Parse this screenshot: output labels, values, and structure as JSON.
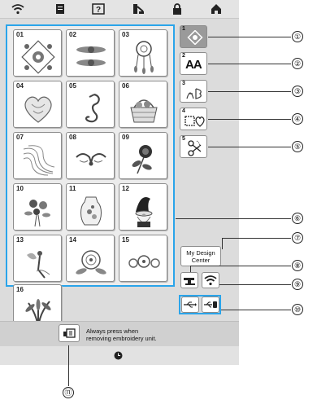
{
  "top_icons": [
    "wifi-icon",
    "document-icon",
    "help-icon",
    "thread-icon",
    "lock-icon",
    "home-icon"
  ],
  "designs": [
    {
      "num": "01",
      "icon": "ornament-square-icon"
    },
    {
      "num": "02",
      "icon": "floral-border-icon"
    },
    {
      "num": "03",
      "icon": "dreamcatcher-icon"
    },
    {
      "num": "04",
      "icon": "lace-heart-icon"
    },
    {
      "num": "05",
      "icon": "seahorse-icon"
    },
    {
      "num": "06",
      "icon": "basket-icon"
    },
    {
      "num": "07",
      "icon": "quilting-swirl-icon"
    },
    {
      "num": "08",
      "icon": "scroll-ornament-icon"
    },
    {
      "num": "09",
      "icon": "rose-icon"
    },
    {
      "num": "10",
      "icon": "bouquet-icon"
    },
    {
      "num": "11",
      "icon": "vase-icon"
    },
    {
      "num": "12",
      "icon": "gnome-icon"
    },
    {
      "num": "13",
      "icon": "fairy-icon"
    },
    {
      "num": "14",
      "icon": "peony-icon"
    },
    {
      "num": "15",
      "icon": "flower-row-icon"
    },
    {
      "num": "16",
      "icon": "palm-leaves-icon"
    }
  ],
  "categories": [
    {
      "num": "1",
      "icon": "embroidery-pattern-icon"
    },
    {
      "num": "2",
      "icon": "alphabet-font-icon",
      "text": "AA"
    },
    {
      "num": "3",
      "icon": "monogram-icon"
    },
    {
      "num": "4",
      "icon": "frame-shapes-icon"
    },
    {
      "num": "5",
      "icon": "scissors-pattern-icon"
    }
  ],
  "my_design_center": "My Design\nCenter",
  "message": "Always press when\nremoving embroidery unit.",
  "callouts": [
    "①",
    "②",
    "③",
    "④",
    "⑤",
    "⑥",
    "⑦",
    "⑧",
    "⑨",
    "⑩",
    "⑪"
  ],
  "colors": {
    "highlight": "#2aa4ea",
    "selected": "#9a9a9a"
  }
}
